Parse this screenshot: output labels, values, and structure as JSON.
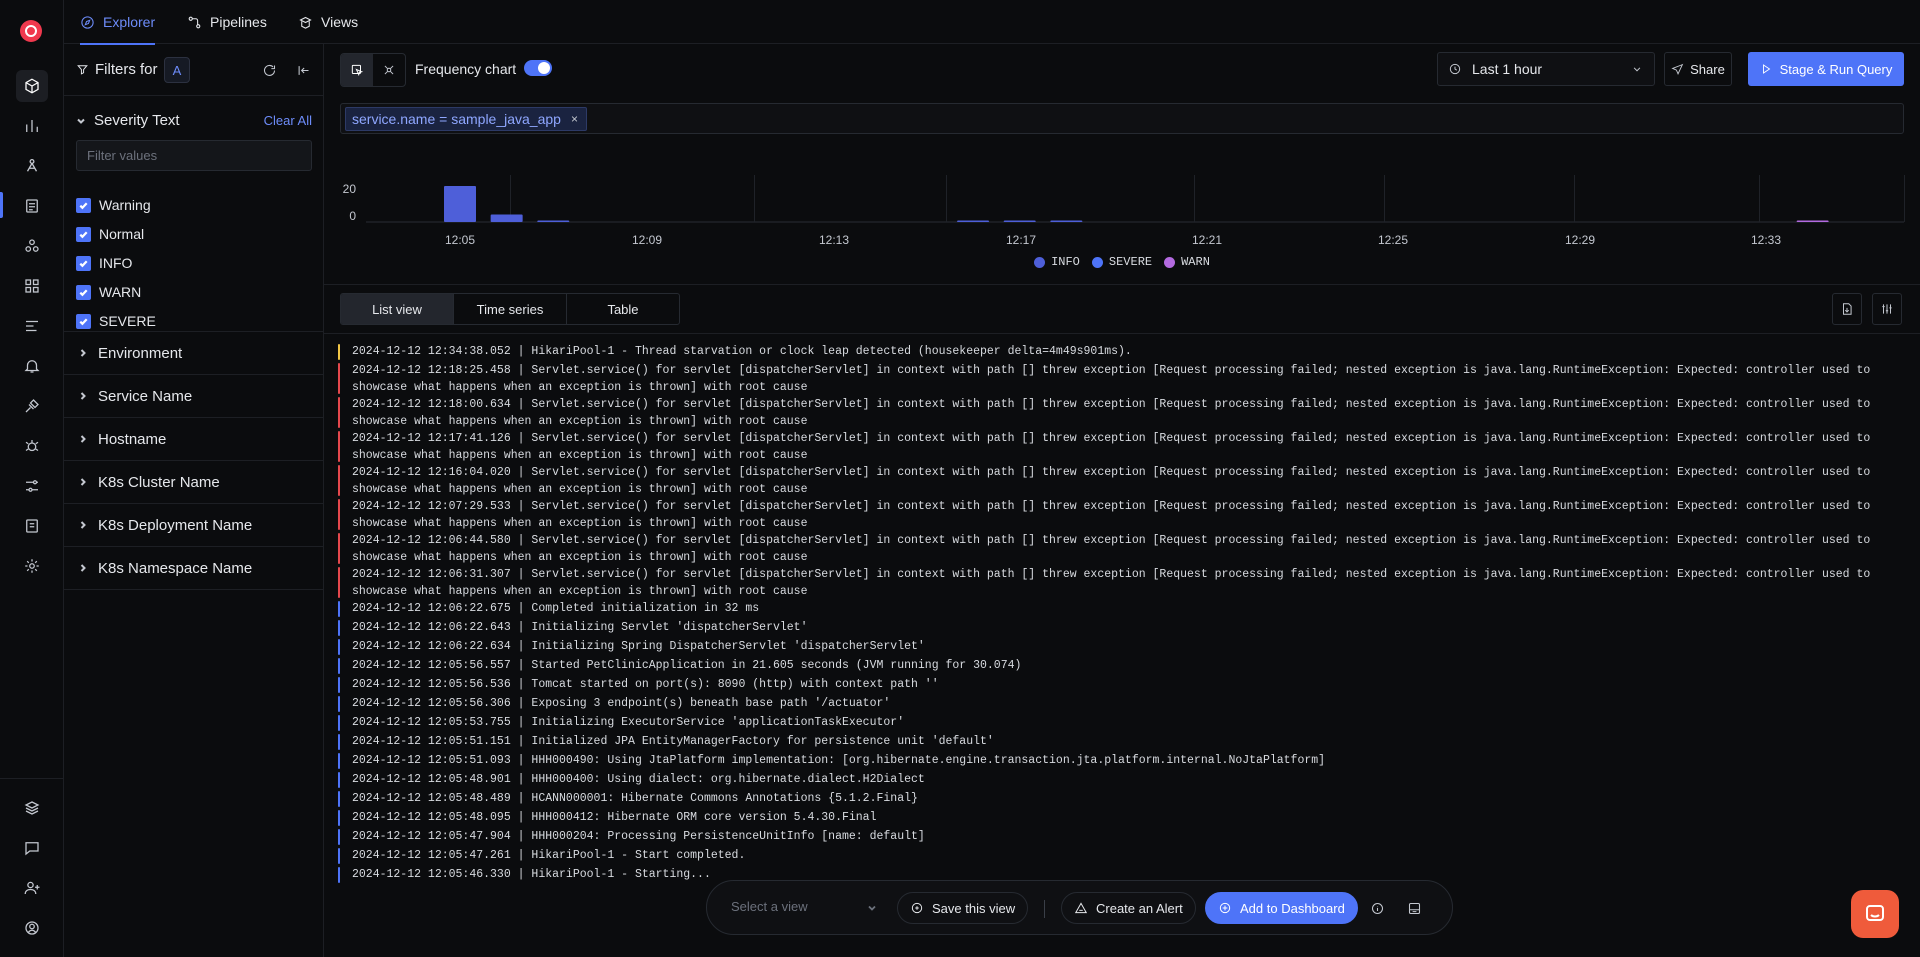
{
  "nav": {
    "tabs": [
      {
        "label": "Explorer",
        "icon": "compass-icon"
      },
      {
        "label": "Pipelines",
        "icon": "pipeline-icon"
      },
      {
        "label": "Views",
        "icon": "views-icon"
      }
    ]
  },
  "filters": {
    "title": "Filters for",
    "query_badge": "A",
    "severity": {
      "title": "Severity Text",
      "clear_label": "Clear All",
      "placeholder": "Filter values",
      "options": [
        "Warning",
        "Normal",
        "INFO",
        "WARN",
        "SEVERE"
      ]
    },
    "sections": [
      "Environment",
      "Service Name",
      "Hostname",
      "K8s Cluster Name",
      "K8s Deployment Name",
      "K8s Namespace Name"
    ]
  },
  "toolbar": {
    "frequency_label": "Frequency chart",
    "frequency_on": true,
    "time_range": "Last 1 hour",
    "share_label": "Share",
    "run_label": "Stage & Run Query"
  },
  "query": {
    "chip": "service.name = sample_java_app",
    "remove": "×"
  },
  "chart_data": {
    "type": "bar",
    "y_ticks": [
      "20",
      "0"
    ],
    "ylim": [
      0,
      30
    ],
    "x_ticks": [
      "12:05",
      "12:09",
      "12:13",
      "12:17",
      "12:21",
      "12:25",
      "12:29",
      "12:33"
    ],
    "legend": [
      "INFO",
      "SEVERE",
      "WARN"
    ],
    "series": [
      {
        "name": "INFO",
        "color": "#4e5fd9",
        "values": [
          {
            "t": "12:05",
            "v": 24
          },
          {
            "t": "12:06",
            "v": 5
          },
          {
            "t": "12:07",
            "v": 1
          }
        ]
      },
      {
        "name": "SEVERE",
        "color": "#4e5fd9",
        "values": [
          {
            "t": "12:16",
            "v": 1
          },
          {
            "t": "12:17",
            "v": 1
          },
          {
            "t": "12:18",
            "v": 1
          }
        ]
      },
      {
        "name": "WARN",
        "color": "#b36ae0",
        "values": [
          {
            "t": "12:34",
            "v": 1
          }
        ]
      }
    ]
  },
  "view_tabs": [
    "List view",
    "Time series",
    "Table"
  ],
  "logs": [
    {
      "sev": "warn",
      "text": "2024-12-12 12:34:38.052 | HikariPool-1 - Thread starvation or clock leap detected (housekeeper delta=4m49s901ms)."
    },
    {
      "sev": "severe",
      "text": "2024-12-12 12:18:25.458 | Servlet.service() for servlet [dispatcherServlet] in context with path [] threw exception [Request processing failed; nested exception is java.lang.RuntimeException: Expected: controller used to showcase what happens when an exception is thrown] with root cause"
    },
    {
      "sev": "severe",
      "text": "2024-12-12 12:18:00.634 | Servlet.service() for servlet [dispatcherServlet] in context with path [] threw exception [Request processing failed; nested exception is java.lang.RuntimeException: Expected: controller used to showcase what happens when an exception is thrown] with root cause"
    },
    {
      "sev": "severe",
      "text": "2024-12-12 12:17:41.126 | Servlet.service() for servlet [dispatcherServlet] in context with path [] threw exception [Request processing failed; nested exception is java.lang.RuntimeException: Expected: controller used to showcase what happens when an exception is thrown] with root cause"
    },
    {
      "sev": "severe",
      "text": "2024-12-12 12:16:04.020 | Servlet.service() for servlet [dispatcherServlet] in context with path [] threw exception [Request processing failed; nested exception is java.lang.RuntimeException: Expected: controller used to showcase what happens when an exception is thrown] with root cause"
    },
    {
      "sev": "severe",
      "text": "2024-12-12 12:07:29.533 | Servlet.service() for servlet [dispatcherServlet] in context with path [] threw exception [Request processing failed; nested exception is java.lang.RuntimeException: Expected: controller used to showcase what happens when an exception is thrown] with root cause"
    },
    {
      "sev": "severe",
      "text": "2024-12-12 12:06:44.580 | Servlet.service() for servlet [dispatcherServlet] in context with path [] threw exception [Request processing failed; nested exception is java.lang.RuntimeException: Expected: controller used to showcase what happens when an exception is thrown] with root cause"
    },
    {
      "sev": "severe",
      "text": "2024-12-12 12:06:31.307 | Servlet.service() for servlet [dispatcherServlet] in context with path [] threw exception [Request processing failed; nested exception is java.lang.RuntimeException: Expected: controller used to showcase what happens when an exception is thrown] with root cause"
    },
    {
      "sev": "info",
      "text": "2024-12-12 12:06:22.675 | Completed initialization in 32 ms"
    },
    {
      "sev": "info",
      "text": "2024-12-12 12:06:22.643 | Initializing Servlet 'dispatcherServlet'"
    },
    {
      "sev": "info",
      "text": "2024-12-12 12:06:22.634 | Initializing Spring DispatcherServlet 'dispatcherServlet'"
    },
    {
      "sev": "info",
      "text": "2024-12-12 12:05:56.557 | Started PetClinicApplication in 21.605 seconds (JVM running for 30.074)"
    },
    {
      "sev": "info",
      "text": "2024-12-12 12:05:56.536 | Tomcat started on port(s): 8090 (http) with context path ''"
    },
    {
      "sev": "info",
      "text": "2024-12-12 12:05:56.306 | Exposing 3 endpoint(s) beneath base path '/actuator'"
    },
    {
      "sev": "info",
      "text": "2024-12-12 12:05:53.755 | Initializing ExecutorService 'applicationTaskExecutor'"
    },
    {
      "sev": "info",
      "text": "2024-12-12 12:05:51.151 | Initialized JPA EntityManagerFactory for persistence unit 'default'"
    },
    {
      "sev": "info",
      "text": "2024-12-12 12:05:51.093 | HHH000490: Using JtaPlatform implementation: [org.hibernate.engine.transaction.jta.platform.internal.NoJtaPlatform]"
    },
    {
      "sev": "info",
      "text": "2024-12-12 12:05:48.901 | HHH000400: Using dialect: org.hibernate.dialect.H2Dialect"
    },
    {
      "sev": "info",
      "text": "2024-12-12 12:05:48.489 | HCANN000001: Hibernate Commons Annotations {5.1.2.Final}"
    },
    {
      "sev": "info",
      "text": "2024-12-12 12:05:48.095 | HHH000412: Hibernate ORM core version 5.4.30.Final"
    },
    {
      "sev": "info",
      "text": "2024-12-12 12:05:47.904 | HHH000204: Processing PersistenceUnitInfo [name: default]"
    },
    {
      "sev": "info",
      "text": "2024-12-12 12:05:47.261 | HikariPool-1 - Start completed."
    },
    {
      "sev": "info",
      "text": "2024-12-12 12:05:46.330 | HikariPool-1 - Starting..."
    }
  ],
  "severity_colors": {
    "warn": "#f3c746",
    "severe": "#e5484d",
    "info": "#4e74f8"
  },
  "bottom": {
    "select_placeholder": "Select a view",
    "save_label": "Save this view",
    "alert_label": "Create an Alert",
    "dashboard_label": "Add to Dashboard"
  }
}
